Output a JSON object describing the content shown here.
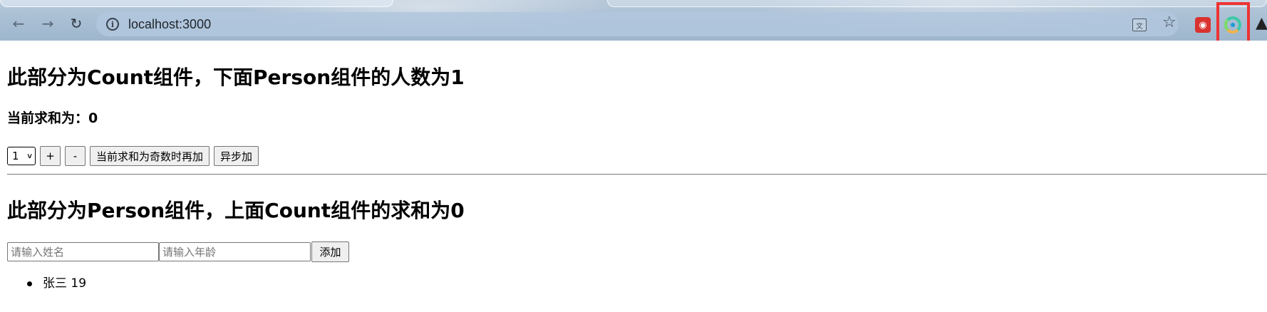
{
  "browser": {
    "url": "localhost:3000",
    "icons": {
      "back": "arrow-left-icon",
      "forward": "arrow-right-icon",
      "reload": "reload-icon",
      "site_info": "info-icon",
      "translate": "translate-icon",
      "bookmark": "star-icon",
      "extension_1": "extension-red-icon",
      "extension_redux": "redux-devtools-icon",
      "extensions_menu": "puzzle-icon"
    },
    "highlight_color": "#ee3333"
  },
  "count_section": {
    "title": "此部分为Count组件，下面Person组件的人数为1",
    "sum_text": "当前求和为：0",
    "select": {
      "selected": "1"
    },
    "buttons": {
      "increment": "+",
      "decrement": "-",
      "increment_if_odd": "当前求和为奇数时再加",
      "increment_async": "异步加"
    }
  },
  "person_section": {
    "title": "此部分为Person组件，上面Count组件的求和为0",
    "name_input": {
      "placeholder": "请输入姓名",
      "value": ""
    },
    "age_input": {
      "placeholder": "请输入年龄",
      "value": ""
    },
    "add_button": "添加",
    "persons": [
      {
        "text": "张三 19"
      }
    ]
  }
}
